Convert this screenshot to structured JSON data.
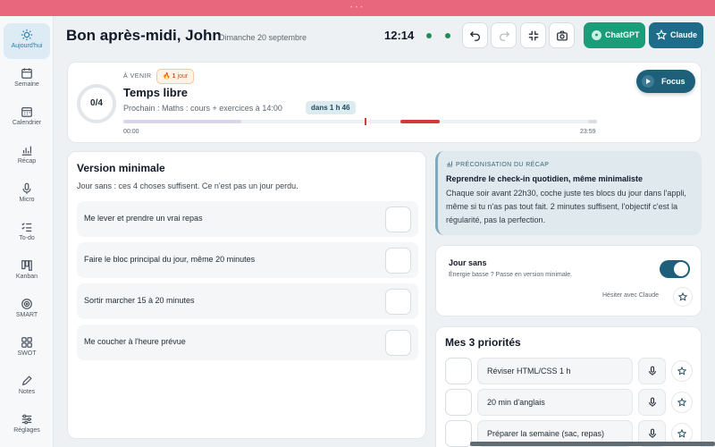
{
  "window": {
    "dots": "• • •"
  },
  "sidebar": {
    "items": [
      {
        "label": "Aujourd'hui",
        "icon": "sun-icon",
        "active": true
      },
      {
        "label": "Semaine",
        "icon": "calendar-week-icon"
      },
      {
        "label": "Calendrier",
        "icon": "calendar-icon"
      },
      {
        "label": "Récap",
        "icon": "chart-icon"
      },
      {
        "label": "Micro",
        "icon": "microphone-icon"
      },
      {
        "label": "To-do",
        "icon": "checklist-icon"
      },
      {
        "label": "Kanban",
        "icon": "kanban-icon"
      },
      {
        "label": "SMART",
        "icon": "target-icon"
      },
      {
        "label": "SWOT",
        "icon": "grid-icon"
      },
      {
        "label": "Notes",
        "icon": "pencil-icon"
      },
      {
        "label": "Réglages",
        "icon": "sliders-icon"
      }
    ]
  },
  "header": {
    "greeting": "Bon après-midi, John",
    "date": "Dimanche 20 septembre",
    "time": "12:14",
    "chatgpt_label": "ChatGPT",
    "claude_label": "Claude"
  },
  "upcoming": {
    "label": "À VENIR",
    "streak_count": "1",
    "streak_unit": "jour",
    "progress": "0/4",
    "title": "Temps libre",
    "subtitle": "Prochain : Maths : cours + exercices à 14:00",
    "countdown": "dans 1 h 46",
    "start_time": "00:00",
    "end_time": "23:59",
    "focus_label": "Focus"
  },
  "minimal": {
    "title": "Version minimale",
    "subtitle": "Jour sans : ces 4 choses suffisent. Ce n'est pas un jour perdu.",
    "items": [
      "Me lever et prendre un vrai repas",
      "Faire le bloc principal du jour, même 20 minutes",
      "Sortir marcher 15 à 20 minutes",
      "Me coucher à l'heure prévue"
    ]
  },
  "recap": {
    "header": "PRÉCONISATION DU RÉCAP",
    "title": "Reprendre le check-in quotidien, même minimaliste",
    "body": "Chaque soir avant 22h30, coche juste tes blocs du jour dans l'appli, même si tu n'as pas tout fait. 2 minutes suffisent, l'objectif c'est la régularité, pas la perfection."
  },
  "jour_sans": {
    "title": "Jour sans",
    "subtitle": "Énergie basse ? Passe en version minimale.",
    "enabled": true,
    "ask_label": "Hésiter avec Claude"
  },
  "priorities": {
    "title": "Mes 3 priorités",
    "items": [
      "Réviser HTML/CSS 1 h",
      "20 min d'anglais",
      "Préparer la semaine (sac, repas)"
    ]
  },
  "colors": {
    "accent": "#1e6b8a",
    "brand_top": "#e8677c",
    "chatgpt": "#1a9e79",
    "alert": "#d23a3a"
  }
}
